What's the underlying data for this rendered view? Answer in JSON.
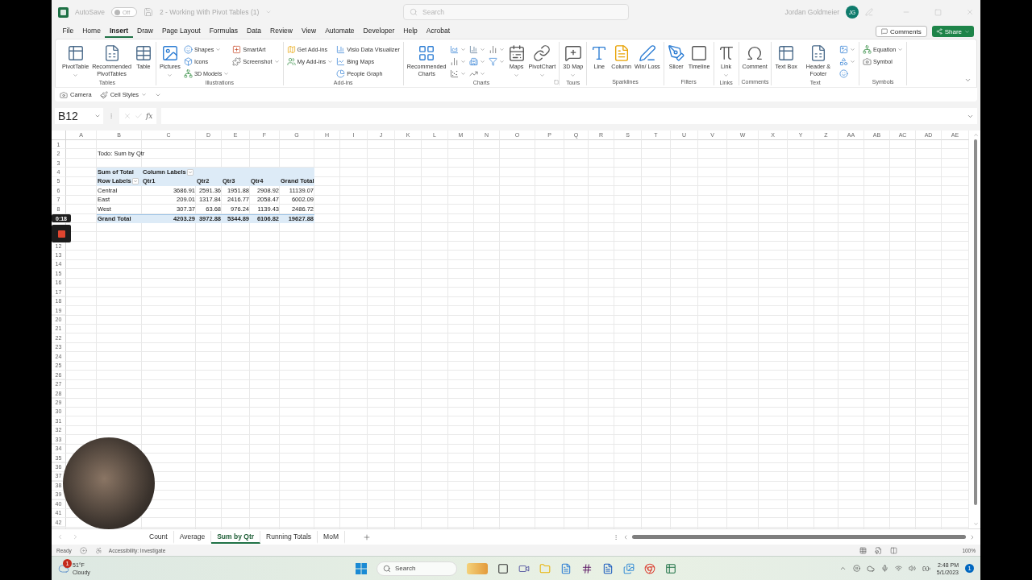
{
  "title_bar": {
    "autosave_label": "AutoSave",
    "autosave": {
      "on": false,
      "label": "Off"
    },
    "document_title": "2 - Working With Pivot Tables (1)",
    "search": {
      "placeholder": "Search"
    },
    "user_name": "Jordan Goldmeier",
    "user_initials": "JG"
  },
  "menu": {
    "tabs": [
      {
        "label": "File",
        "selected": false
      },
      {
        "label": "Home",
        "selected": false
      },
      {
        "label": "Insert",
        "selected": true
      },
      {
        "label": "Draw",
        "selected": false
      },
      {
        "label": "Page Layout",
        "selected": false
      },
      {
        "label": "Formulas",
        "selected": false
      },
      {
        "label": "Data",
        "selected": false
      },
      {
        "label": "Review",
        "selected": false
      },
      {
        "label": "View",
        "selected": false
      },
      {
        "label": "Automate",
        "selected": false
      },
      {
        "label": "Developer",
        "selected": false
      },
      {
        "label": "Help",
        "selected": false
      },
      {
        "label": "Acrobat",
        "selected": false
      }
    ],
    "comments_button": "Comments",
    "share_button": "Share"
  },
  "ribbon": {
    "groups": [
      {
        "label": "Tables",
        "launcher": false,
        "items": [
          {
            "kind": "large",
            "label": "PivotTable",
            "dropdown": true
          },
          {
            "kind": "large",
            "label": "Recommended PivotTables",
            "dropdown": false
          },
          {
            "kind": "large",
            "label": "Table",
            "dropdown": false
          }
        ]
      },
      {
        "label": "Illustrations",
        "launcher": false,
        "items": [
          {
            "kind": "large",
            "label": "Pictures",
            "dropdown": true
          },
          {
            "kind": "stack",
            "items": [
              {
                "kind": "small",
                "label": "Shapes",
                "dropdown": true
              },
              {
                "kind": "small",
                "label": "Icons",
                "dropdown": false
              },
              {
                "kind": "small",
                "label": "3D Models",
                "dropdown": true
              }
            ]
          },
          {
            "kind": "stack",
            "items": [
              {
                "kind": "small",
                "label": "SmartArt",
                "dropdown": false
              },
              {
                "kind": "small",
                "label": "Screenshot",
                "dropdown": true
              }
            ]
          }
        ]
      },
      {
        "label": "Add-ins",
        "launcher": false,
        "items": [
          {
            "kind": "stack",
            "items": [
              {
                "kind": "small",
                "label": "Get Add-ins",
                "dropdown": false
              },
              {
                "kind": "small",
                "label": "My Add-ins",
                "dropdown": true
              }
            ]
          },
          {
            "kind": "stack",
            "items": [
              {
                "kind": "small",
                "label": "Visio Data Visualizer",
                "dropdown": false
              },
              {
                "kind": "small",
                "label": "Bing Maps",
                "dropdown": false
              },
              {
                "kind": "small",
                "label": "People Graph",
                "dropdown": false
              }
            ]
          }
        ]
      },
      {
        "label": "Charts",
        "launcher": true,
        "items": [
          {
            "kind": "large",
            "label": "Recommended Charts",
            "dropdown": false
          },
          {
            "kind": "stack",
            "items": [
              {
                "kind": "small",
                "dropdown": true
              },
              {
                "kind": "small",
                "dropdown": true
              },
              {
                "kind": "small",
                "dropdown": true
              }
            ]
          },
          {
            "kind": "stack",
            "items": [
              {
                "kind": "small",
                "dropdown": true
              },
              {
                "kind": "small",
                "dropdown": true
              },
              {
                "kind": "small",
                "dropdown": true
              }
            ]
          },
          {
            "kind": "stack",
            "items": [
              {
                "kind": "small",
                "dropdown": true
              },
              {
                "kind": "small",
                "dropdown": true
              }
            ]
          },
          {
            "kind": "large",
            "label": "Maps",
            "dropdown": true
          },
          {
            "kind": "large",
            "label": "PivotChart",
            "dropdown": true
          }
        ]
      },
      {
        "label": "Tours",
        "launcher": false,
        "items": [
          {
            "kind": "large",
            "label": "3D Map",
            "dropdown": true
          }
        ]
      },
      {
        "label": "Sparklines",
        "launcher": false,
        "items": [
          {
            "kind": "large",
            "label": "Line",
            "dropdown": false
          },
          {
            "kind": "large",
            "label": "Column",
            "dropdown": false
          },
          {
            "kind": "large",
            "label": "Win/ Loss",
            "dropdown": false
          }
        ]
      },
      {
        "label": "Filters",
        "launcher": false,
        "items": [
          {
            "kind": "large",
            "label": "Slicer",
            "dropdown": false
          },
          {
            "kind": "large",
            "label": "Timeline",
            "dropdown": false
          }
        ]
      },
      {
        "label": "Links",
        "launcher": false,
        "items": [
          {
            "kind": "large",
            "label": "Link",
            "dropdown": true
          }
        ]
      },
      {
        "label": "Comments",
        "launcher": false,
        "items": [
          {
            "kind": "large",
            "label": "Comment",
            "dropdown": false
          }
        ]
      },
      {
        "label": "Text",
        "launcher": false,
        "items": [
          {
            "kind": "large",
            "label": "Text Box",
            "dropdown": false
          },
          {
            "kind": "large",
            "label": "Header & Footer",
            "dropdown": false
          },
          {
            "kind": "stack",
            "items": [
              {
                "kind": "small",
                "dropdown": true
              },
              {
                "kind": "small",
                "dropdown": true
              },
              {
                "kind": "small",
                "dropdown": false
              }
            ]
          }
        ]
      },
      {
        "label": "Symbols",
        "launcher": false,
        "items": [
          {
            "kind": "stack",
            "items": [
              {
                "kind": "small",
                "label": "Equation",
                "dropdown": true
              },
              {
                "kind": "small",
                "label": "Symbol",
                "dropdown": false
              }
            ]
          }
        ]
      }
    ]
  },
  "quick_access": {
    "items": [
      {
        "label": "Camera",
        "dropdown": false
      },
      {
        "label": "Cell Styles",
        "dropdown": true
      }
    ]
  },
  "formula_bar": {
    "name_box": "B12",
    "function_label": "fx"
  },
  "sheet": {
    "columns": [
      "A",
      "B",
      "C",
      "D",
      "E",
      "F",
      "G",
      "H",
      "I",
      "J",
      "K",
      "L",
      "M",
      "N",
      "O",
      "P",
      "Q",
      "R",
      "S",
      "T",
      "U",
      "V",
      "W",
      "X",
      "Y",
      "Z",
      "AA",
      "AB",
      "AC",
      "AD",
      "AE"
    ],
    "rows_above_recorder": [
      "1",
      "2",
      "3",
      "4",
      "5",
      "6",
      "7",
      "8"
    ],
    "rows_below_recorder": [
      "12",
      "13",
      "14",
      "15",
      "16",
      "17",
      "18",
      "19",
      "20",
      "21",
      "22",
      "23",
      "24",
      "25",
      "26",
      "27",
      "28",
      "29",
      "30",
      "31",
      "32",
      "33",
      "34",
      "35",
      "36",
      "37",
      "38",
      "39",
      "40",
      "41",
      "42"
    ],
    "note": "Todo: Sum by Qtr",
    "pivot_table": {
      "value_field": "Sum of Total",
      "column_labels": "Column Labels",
      "row_labels": "Row Labels",
      "columns": [
        "Qtr1",
        "Qtr2",
        "Qtr3",
        "Qtr4",
        "Grand Total"
      ],
      "rows": [
        {
          "label": "Central",
          "values": [
            "3686.91",
            "2591.36",
            "1951.88",
            "2908.92",
            "11139.07"
          ]
        },
        {
          "label": "East",
          "values": [
            "209.01",
            "1317.84",
            "2416.77",
            "2058.47",
            "6002.09"
          ]
        },
        {
          "label": "West",
          "values": [
            "307.37",
            "63.68",
            "976.24",
            "1139.43",
            "2486.72"
          ]
        }
      ],
      "total": {
        "label": "Grand Total",
        "values": [
          "4203.29",
          "3972.88",
          "5344.89",
          "6106.82",
          "19627.88"
        ]
      }
    }
  },
  "recording": {
    "elapsed": "0:18"
  },
  "sheet_tabs": [
    {
      "label": "Count",
      "selected": false
    },
    {
      "label": "Average",
      "selected": false
    },
    {
      "label": "Sum by Qtr",
      "selected": true
    },
    {
      "label": "Running Totals",
      "selected": false
    },
    {
      "label": "MoM",
      "selected": false
    }
  ],
  "status_bar": {
    "status": "Ready",
    "accessibility": "Accessibility: Investigate",
    "zoom": "100%"
  },
  "taskbar": {
    "weather": {
      "temperature": "51°F",
      "condition": "Cloudy",
      "alerts": "1"
    },
    "search": {
      "placeholder": "Search"
    },
    "time": "2:48 PM",
    "date": "5/1/2023",
    "notifications": "1"
  }
}
